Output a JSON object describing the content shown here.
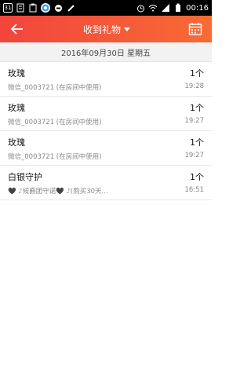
{
  "status_bar": {
    "left_icons": [
      "31-calendar-icon",
      "document-icon",
      "clipboard-icon",
      "app-circle-icon",
      "message-circle-icon",
      "pencil-icon"
    ],
    "time": "00:16",
    "calendar_num": "31"
  },
  "header": {
    "title": "收到礼物"
  },
  "date_bar": {
    "text": "2016年09月30日 星期五"
  },
  "gifts": [
    {
      "name": "玫瑰",
      "sub": "微信_0003721 (在房间中使用)",
      "qty": "1个",
      "time": "19:28"
    },
    {
      "name": "玫瑰",
      "sub": "微信_0003721 (在房间中使用)",
      "qty": "1个",
      "time": "19:27"
    },
    {
      "name": "玫瑰",
      "sub": "微信_0003721 (在房间中使用)",
      "qty": "1个",
      "time": "19:27"
    },
    {
      "name": "白银守护",
      "sub": "🖤 ♪候爵团守诺🖤 ♪(购买30天...",
      "qty": "1个",
      "time": "16:51"
    }
  ]
}
